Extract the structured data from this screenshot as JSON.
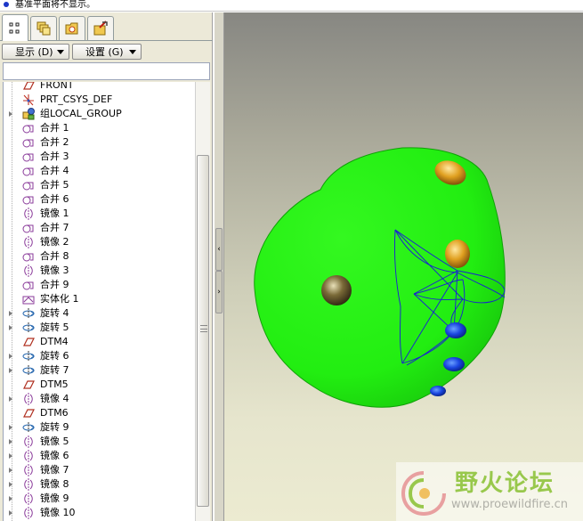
{
  "message_bar": {
    "text": "基准平面将不显示。"
  },
  "tabs": [
    {
      "icon": "model-tree-icon",
      "active": true
    },
    {
      "icon": "layers-icon",
      "active": false
    },
    {
      "icon": "folder-icon",
      "active": false
    },
    {
      "icon": "favorites-icon",
      "active": false
    }
  ],
  "toolbar": {
    "show_label": "显示 (D)",
    "settings_label": "设置 (G)"
  },
  "model_tree": {
    "items": [
      {
        "label": "FRONT",
        "icon": "datum-plane-icon",
        "expandable": false
      },
      {
        "label": "PRT_CSYS_DEF",
        "icon": "csys-icon",
        "expandable": false
      },
      {
        "label": "组LOCAL_GROUP",
        "icon": "group-icon",
        "expandable": true
      },
      {
        "label": "合并 1",
        "icon": "merge-icon",
        "expandable": false
      },
      {
        "label": "合并 2",
        "icon": "merge-icon",
        "expandable": false
      },
      {
        "label": "合并 3",
        "icon": "merge-icon",
        "expandable": false
      },
      {
        "label": "合并 4",
        "icon": "merge-icon",
        "expandable": false
      },
      {
        "label": "合并 5",
        "icon": "merge-icon",
        "expandable": false
      },
      {
        "label": "合并 6",
        "icon": "merge-icon",
        "expandable": false
      },
      {
        "label": "镜像 1",
        "icon": "mirror-icon",
        "expandable": false
      },
      {
        "label": "合并 7",
        "icon": "merge-icon",
        "expandable": false
      },
      {
        "label": "镜像 2",
        "icon": "mirror-icon",
        "expandable": false
      },
      {
        "label": "合并 8",
        "icon": "merge-icon",
        "expandable": false
      },
      {
        "label": "镜像 3",
        "icon": "mirror-icon",
        "expandable": false
      },
      {
        "label": "合并 9",
        "icon": "merge-icon",
        "expandable": false
      },
      {
        "label": "实体化 1",
        "icon": "solidify-icon",
        "expandable": false
      },
      {
        "label": "旋转 4",
        "icon": "revolve-icon",
        "expandable": true
      },
      {
        "label": "旋转 5",
        "icon": "revolve-icon",
        "expandable": true
      },
      {
        "label": "DTM4",
        "icon": "datum-plane-icon",
        "expandable": false
      },
      {
        "label": "旋转 6",
        "icon": "revolve-icon",
        "expandable": true
      },
      {
        "label": "旋转 7",
        "icon": "revolve-icon",
        "expandable": true
      },
      {
        "label": "DTM5",
        "icon": "datum-plane-icon",
        "expandable": false
      },
      {
        "label": "镜像 4",
        "icon": "mirror-icon",
        "expandable": true
      },
      {
        "label": "DTM6",
        "icon": "datum-plane-icon",
        "expandable": false
      },
      {
        "label": "旋转 9",
        "icon": "revolve-icon",
        "expandable": true
      },
      {
        "label": "镜像 5",
        "icon": "mirror-icon",
        "expandable": true
      },
      {
        "label": "镜像 6",
        "icon": "mirror-icon",
        "expandable": true
      },
      {
        "label": "镜像 7",
        "icon": "mirror-icon",
        "expandable": true
      },
      {
        "label": "镜像 8",
        "icon": "mirror-icon",
        "expandable": true
      },
      {
        "label": "镜像 9",
        "icon": "mirror-icon",
        "expandable": true
      },
      {
        "label": "镜像 10",
        "icon": "mirror-icon",
        "expandable": true
      }
    ]
  },
  "viewport": {
    "model_color": "#22ee11",
    "edge_color": "#1a1ad8",
    "background_top": "#878782",
    "background_bottom": "#ecebd1"
  },
  "watermark": {
    "title": "野火论坛",
    "url": "www.proewildfire.cn"
  }
}
